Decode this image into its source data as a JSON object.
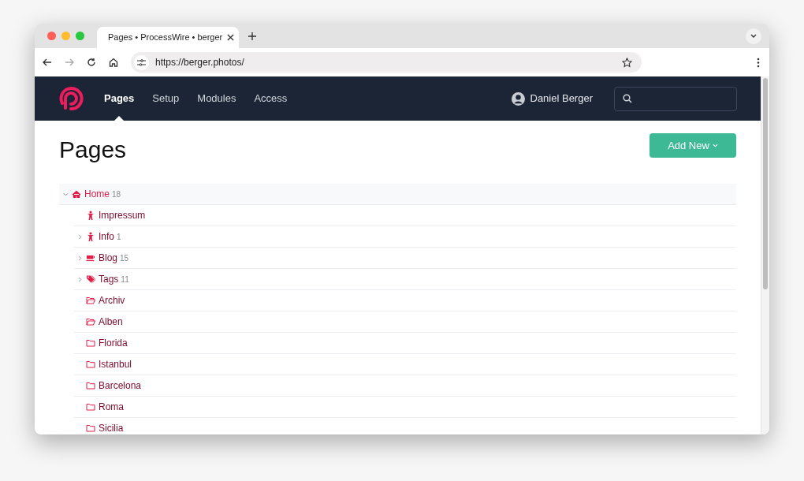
{
  "browser": {
    "tab_title": "Pages • ProcessWire • berger",
    "url": "https://berger.photos/"
  },
  "nav": {
    "items": [
      {
        "label": "Pages",
        "selected": true
      },
      {
        "label": "Setup",
        "selected": false
      },
      {
        "label": "Modules",
        "selected": false
      },
      {
        "label": "Access",
        "selected": false
      }
    ],
    "user": "Daniel Berger"
  },
  "heading": "Pages",
  "add_button": "Add New",
  "tree": [
    {
      "title": "Home",
      "count": "18",
      "kind": "home",
      "expanded": true,
      "children": [
        {
          "title": "Impressum",
          "kind": "person"
        },
        {
          "title": "Info",
          "count": "1",
          "kind": "person",
          "expanded": false
        },
        {
          "title": "Blog",
          "count": "15",
          "kind": "coffee",
          "expanded": false
        },
        {
          "title": "Tags",
          "count": "11",
          "kind": "tags",
          "expanded": false
        },
        {
          "title": "Archiv",
          "kind": "folder-open"
        },
        {
          "title": "Alben",
          "kind": "folder-open"
        },
        {
          "title": "Florida",
          "kind": "folder"
        },
        {
          "title": "Istanbul",
          "kind": "folder"
        },
        {
          "title": "Barcelona",
          "kind": "folder"
        },
        {
          "title": "Roma",
          "kind": "folder"
        },
        {
          "title": "Sicilia",
          "kind": "folder"
        }
      ]
    }
  ]
}
